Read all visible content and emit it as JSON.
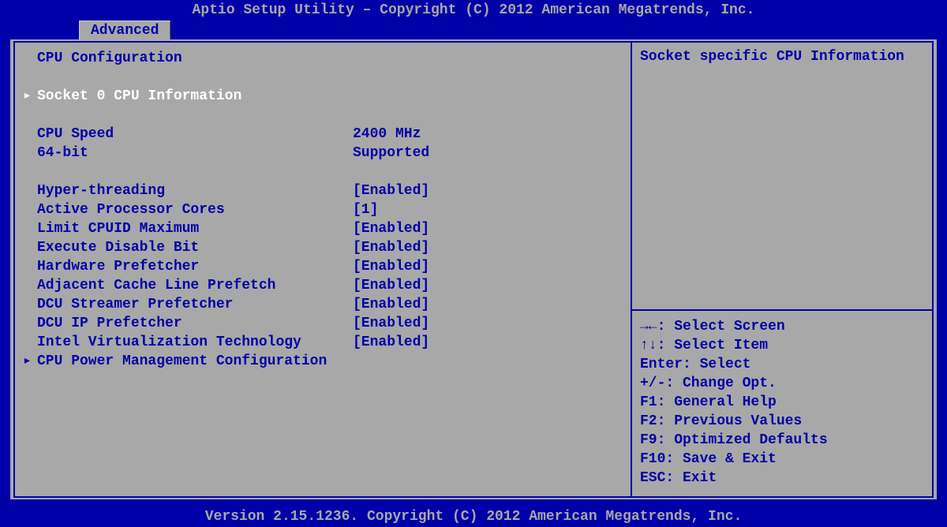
{
  "title": "Aptio Setup Utility – Copyright (C) 2012 American Megatrends, Inc.",
  "footer": "Version 2.15.1236. Copyright (C) 2012 American Megatrends, Inc.",
  "tabs": [
    {
      "label": "Advanced"
    }
  ],
  "main": {
    "heading": "CPU Configuration",
    "selected_submenu": "Socket 0 CPU Information",
    "info": [
      {
        "label": "CPU Speed",
        "value": "2400 MHz"
      },
      {
        "label": "64-bit",
        "value": "Supported"
      }
    ],
    "options": [
      {
        "label": "Hyper-threading",
        "value": "[Enabled]"
      },
      {
        "label": "Active Processor Cores",
        "value": "[1]"
      },
      {
        "label": "Limit CPUID Maximum",
        "value": "[Enabled]"
      },
      {
        "label": "Execute Disable Bit",
        "value": "[Enabled]"
      },
      {
        "label": "Hardware Prefetcher",
        "value": "[Enabled]"
      },
      {
        "label": "Adjacent Cache Line Prefetch",
        "value": "[Enabled]"
      },
      {
        "label": "DCU Streamer Prefetcher",
        "value": "[Enabled]"
      },
      {
        "label": "DCU IP Prefetcher",
        "value": "[Enabled]"
      },
      {
        "label": "Intel Virtualization Technology",
        "value": "[Enabled]"
      }
    ],
    "submenu2": "CPU Power Management Configuration"
  },
  "help": {
    "description": "Socket specific CPU Information",
    "keys": [
      "→←: Select Screen",
      "↑↓: Select Item",
      "Enter: Select",
      "+/-: Change Opt.",
      "F1: General Help",
      "F2: Previous Values",
      "F9: Optimized Defaults",
      "F10: Save & Exit",
      "ESC: Exit"
    ]
  },
  "arrow_glyph": "▸"
}
